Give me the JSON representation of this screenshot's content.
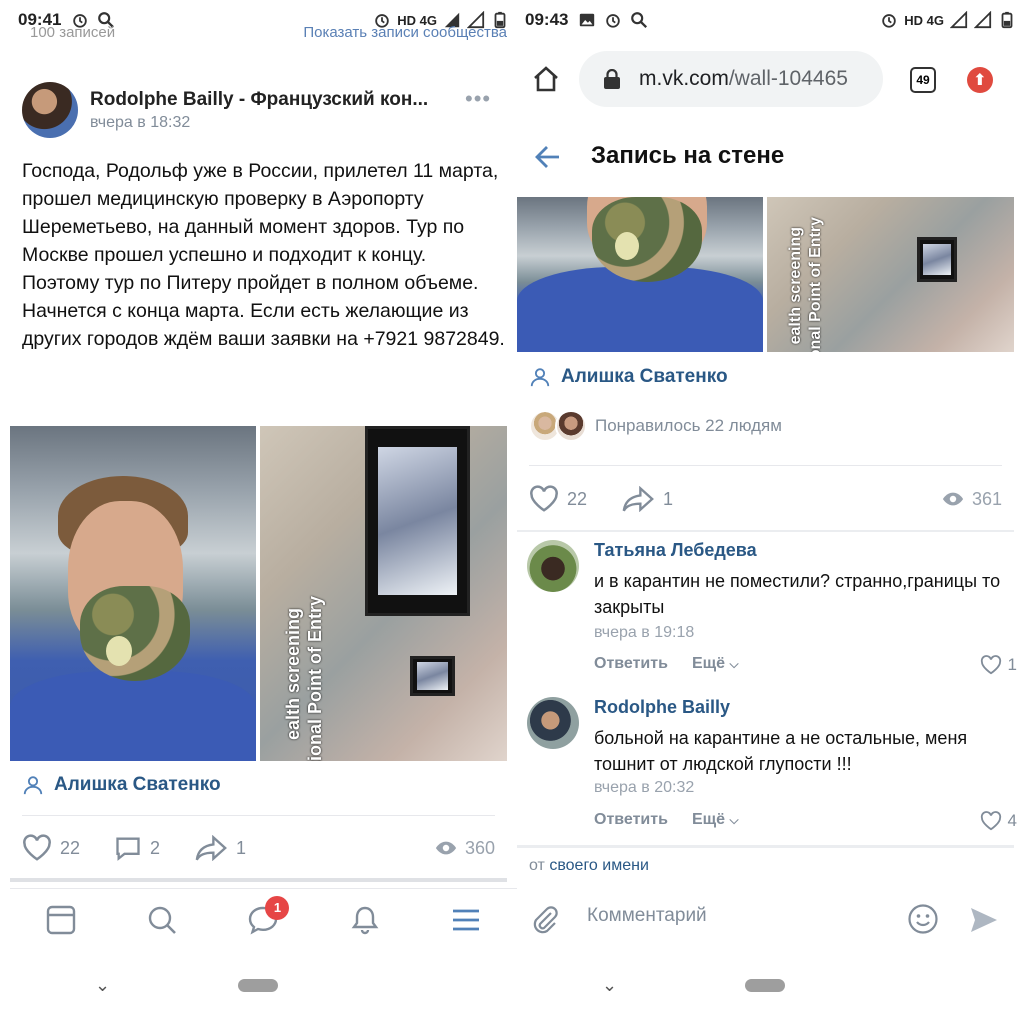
{
  "left": {
    "status": {
      "time": "09:41",
      "network": "HD 4G"
    },
    "cutoff_left": "100 записей",
    "cutoff_right": "Показать записи сообщества",
    "post": {
      "author": "Rodolphe Bailly - Французский кон...",
      "time": "вчера в 18:32",
      "text": "Господа, Родольф уже в России, прилетел 11 марта, прошел медицинскую проверку в Аэропорту Шереметьево, на данный момент здоров. Тур по Москве прошел успешно и подходит к концу.\nПоэтому тур по Питеру пройдет в полном объеме. Начнется с конца марта. Если есть желающие из других городов ждём ваши заявки на +7921 9872849.",
      "photo_text_1": "ealth screening",
      "photo_text_2": "tional Point of Entry",
      "signed_by": "Алишка Сватенко",
      "likes": "22",
      "comments": "2",
      "shares": "1",
      "views": "360"
    },
    "nav_badge": "1"
  },
  "right": {
    "status": {
      "time": "09:43",
      "network": "HD 4G"
    },
    "url_domain": "m.vk.com",
    "url_path": "/wall-104465",
    "tab_count": "49",
    "title": "Запись на стене",
    "photo_text_1": "ealth screening",
    "photo_text_2": "tional Point of Entry",
    "signed_by": "Алишка Сватенко",
    "liked_by": "Понравилось 22 людям",
    "likes": "22",
    "shares": "1",
    "views": "361",
    "comments": [
      {
        "name": "Татьяна Лебедева",
        "text": "и в карантин не поместили? странно,границы то закрыты",
        "time": "вчера в 19:18",
        "reply": "Ответить",
        "more": "Ещё",
        "likes": "1"
      },
      {
        "name": "Rodolphe Bailly",
        "text": "больной на карантине а не остальные, меня тошнит от людской глупости !!!",
        "time": "вчера в 20:32",
        "reply": "Ответить",
        "more": "Ещё",
        "likes": "4"
      }
    ],
    "from_prefix": "от",
    "from_link": "своего имени",
    "comment_placeholder": "Комментарий"
  },
  "colors": {
    "link": "#2a5885",
    "muted": "#818c99",
    "accent": "#5181b8",
    "badge": "#e64646"
  },
  "icons": [
    "alarm-icon",
    "search-icon",
    "signal-icon",
    "battery-icon",
    "more-icon",
    "user-icon",
    "heart-icon",
    "comment-icon",
    "share-icon",
    "eye-icon",
    "news-icon",
    "bell-icon",
    "menu-icon",
    "home-icon",
    "lock-icon",
    "tabs-icon",
    "update-icon",
    "back-icon",
    "attach-icon",
    "smile-icon",
    "send-icon"
  ]
}
